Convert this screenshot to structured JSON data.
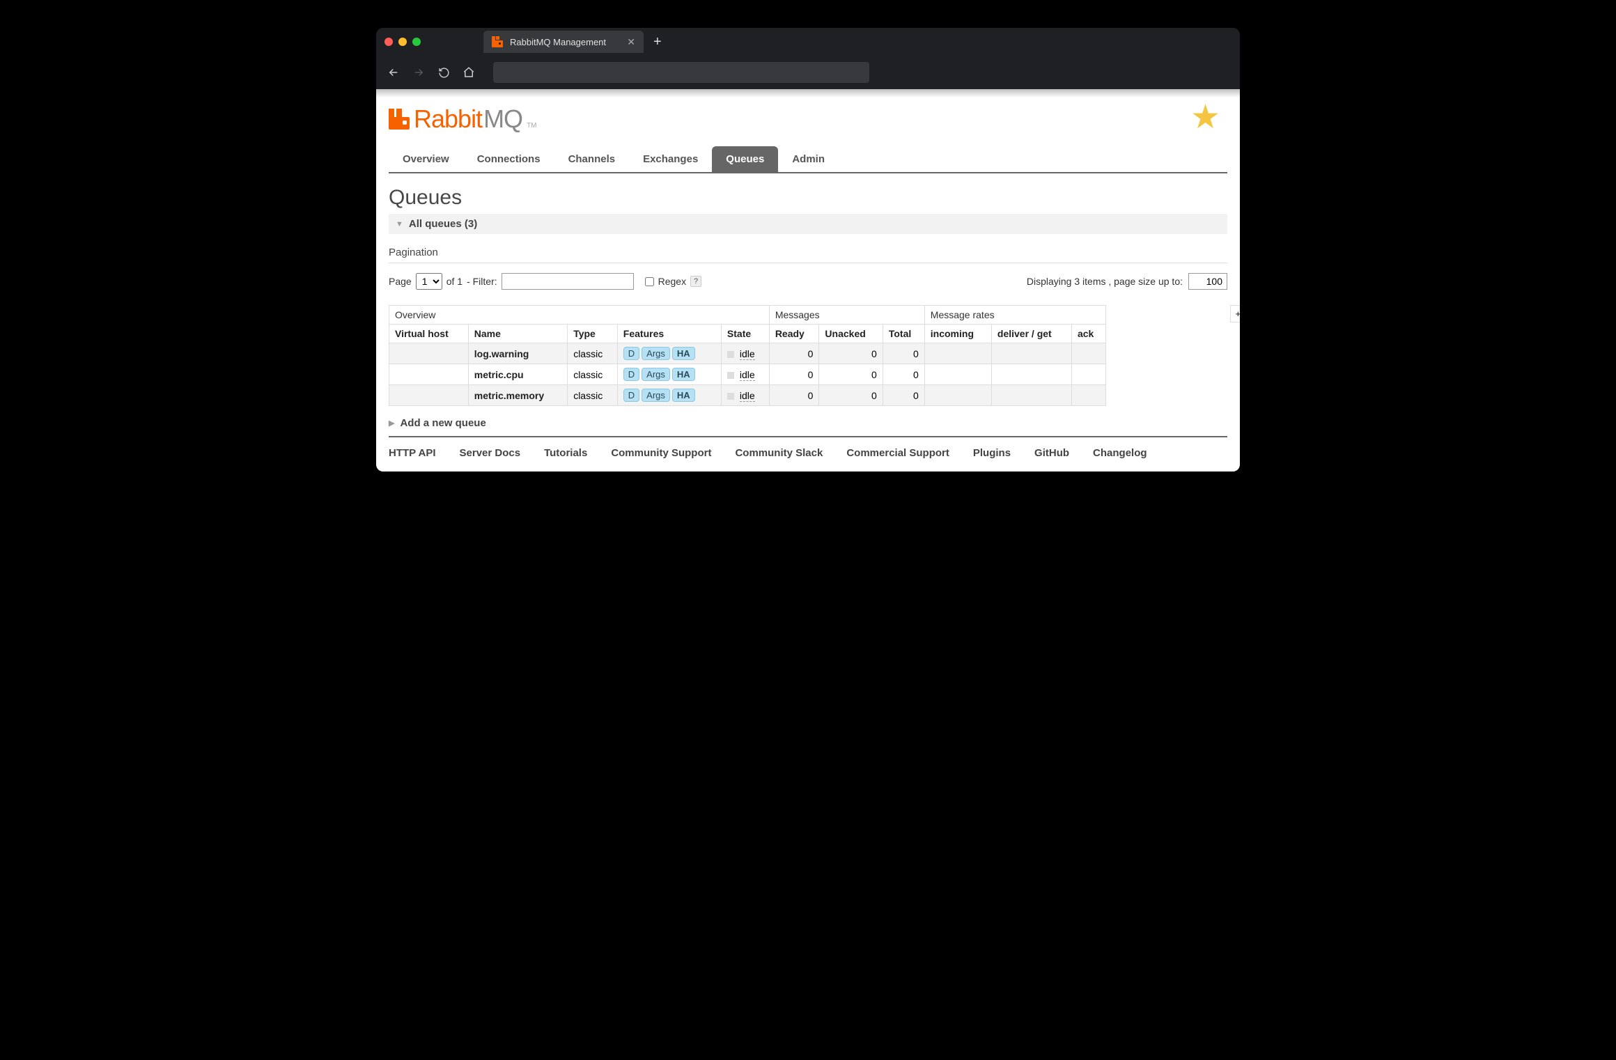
{
  "browser": {
    "tab_title": "RabbitMQ Management"
  },
  "logo": {
    "part1": "Rabbit",
    "part2": "MQ",
    "tm": "TM"
  },
  "nav": {
    "items": [
      "Overview",
      "Connections",
      "Channels",
      "Exchanges",
      "Queues",
      "Admin"
    ],
    "active": "Queues"
  },
  "page": {
    "title": "Queues",
    "all_queues_label": "All queues (3)",
    "pagination_label": "Pagination",
    "page_label": "Page",
    "page_value": "1",
    "of_label": "of 1",
    "filter_label": "- Filter:",
    "filter_value": "",
    "regex_label": "Regex",
    "displaying_label": "Displaying 3 items , page size up to:",
    "page_size": "100",
    "plusminus": "+/-",
    "add_queue_label": "Add a new queue"
  },
  "table": {
    "group_headers": [
      "Overview",
      "Messages",
      "Message rates"
    ],
    "columns": [
      "Virtual host",
      "Name",
      "Type",
      "Features",
      "State",
      "Ready",
      "Unacked",
      "Total",
      "incoming",
      "deliver / get",
      "ack"
    ],
    "feature_badges": [
      "D",
      "Args",
      "HA"
    ],
    "rows": [
      {
        "vhost": "",
        "name": "log.warning",
        "type": "classic",
        "state": "idle",
        "ready": "0",
        "unacked": "0",
        "total": "0",
        "incoming": "",
        "deliver": "",
        "ack": ""
      },
      {
        "vhost": "",
        "name": "metric.cpu",
        "type": "classic",
        "state": "idle",
        "ready": "0",
        "unacked": "0",
        "total": "0",
        "incoming": "",
        "deliver": "",
        "ack": ""
      },
      {
        "vhost": "",
        "name": "metric.memory",
        "type": "classic",
        "state": "idle",
        "ready": "0",
        "unacked": "0",
        "total": "0",
        "incoming": "",
        "deliver": "",
        "ack": ""
      }
    ]
  },
  "footer": {
    "links": [
      "HTTP API",
      "Server Docs",
      "Tutorials",
      "Community Support",
      "Community Slack",
      "Commercial Support",
      "Plugins",
      "GitHub",
      "Changelog"
    ]
  }
}
